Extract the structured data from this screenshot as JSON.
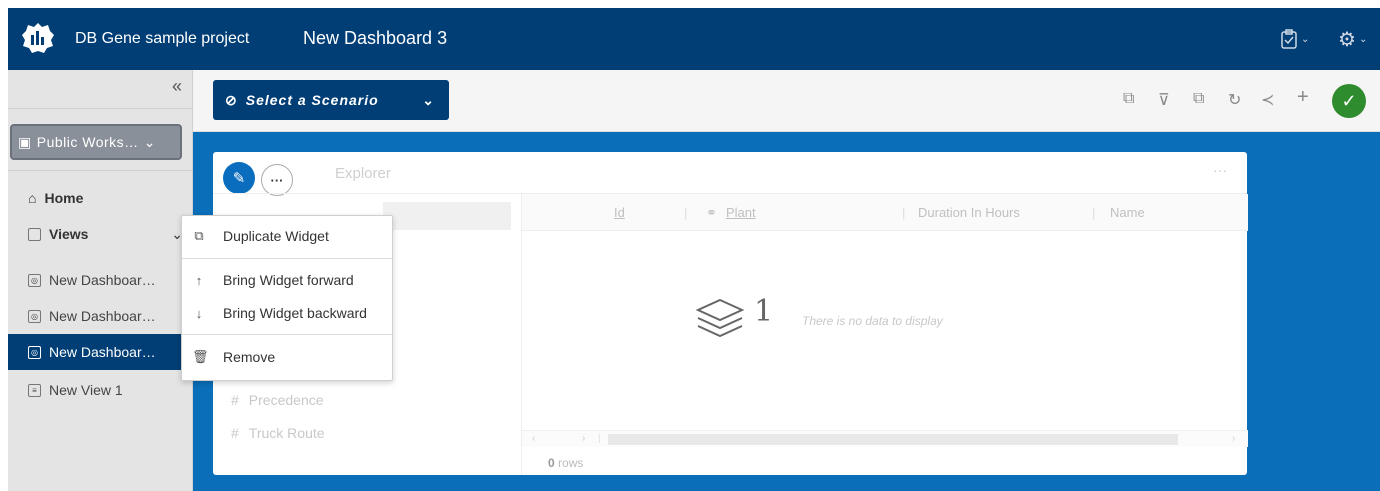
{
  "header": {
    "project_name": "DB Gene sample project",
    "dashboard_name": "New Dashboard 3",
    "icons": [
      "logo-icon",
      "clipboard-check-icon",
      "gear-icon"
    ],
    "accent_color": "#003e75"
  },
  "sidebar": {
    "collapse_icon": "«",
    "workspace_label": "Public Works…",
    "home_label": "Home",
    "views_label": "Views",
    "items": [
      {
        "label": "New Dashboar…",
        "icon": "dashboard-icon",
        "active": false
      },
      {
        "label": "New Dashboar…",
        "icon": "dashboard-icon",
        "active": false
      },
      {
        "label": "New Dashboar…",
        "icon": "dashboard-icon",
        "active": true
      },
      {
        "label": "New View 1",
        "icon": "view-icon",
        "active": false
      }
    ]
  },
  "toolbar": {
    "scenario_label": "Select a Scenario",
    "actions": [
      "copy-icon",
      "filter-icon",
      "open-external-icon",
      "refresh-icon",
      "share-icon",
      "add-icon",
      "confirm-icon"
    ]
  },
  "widget": {
    "title": "Explorer",
    "list_items": [
      "Precedence",
      "Truck Route"
    ],
    "columns": [
      "Id",
      "Plant",
      "Duration In Hours",
      "Name"
    ],
    "empty_count": "1",
    "empty_text": "There is no data to display",
    "row_count": "0",
    "row_suffix": "rows"
  },
  "context_menu": {
    "items": [
      {
        "label": "Duplicate Widget",
        "icon": "duplicate-icon"
      },
      {
        "label": "Bring Widget forward",
        "icon": "arrow-up-icon"
      },
      {
        "label": "Bring Widget backward",
        "icon": "arrow-down-icon"
      },
      {
        "label": "Remove",
        "icon": "trash-icon"
      }
    ]
  }
}
